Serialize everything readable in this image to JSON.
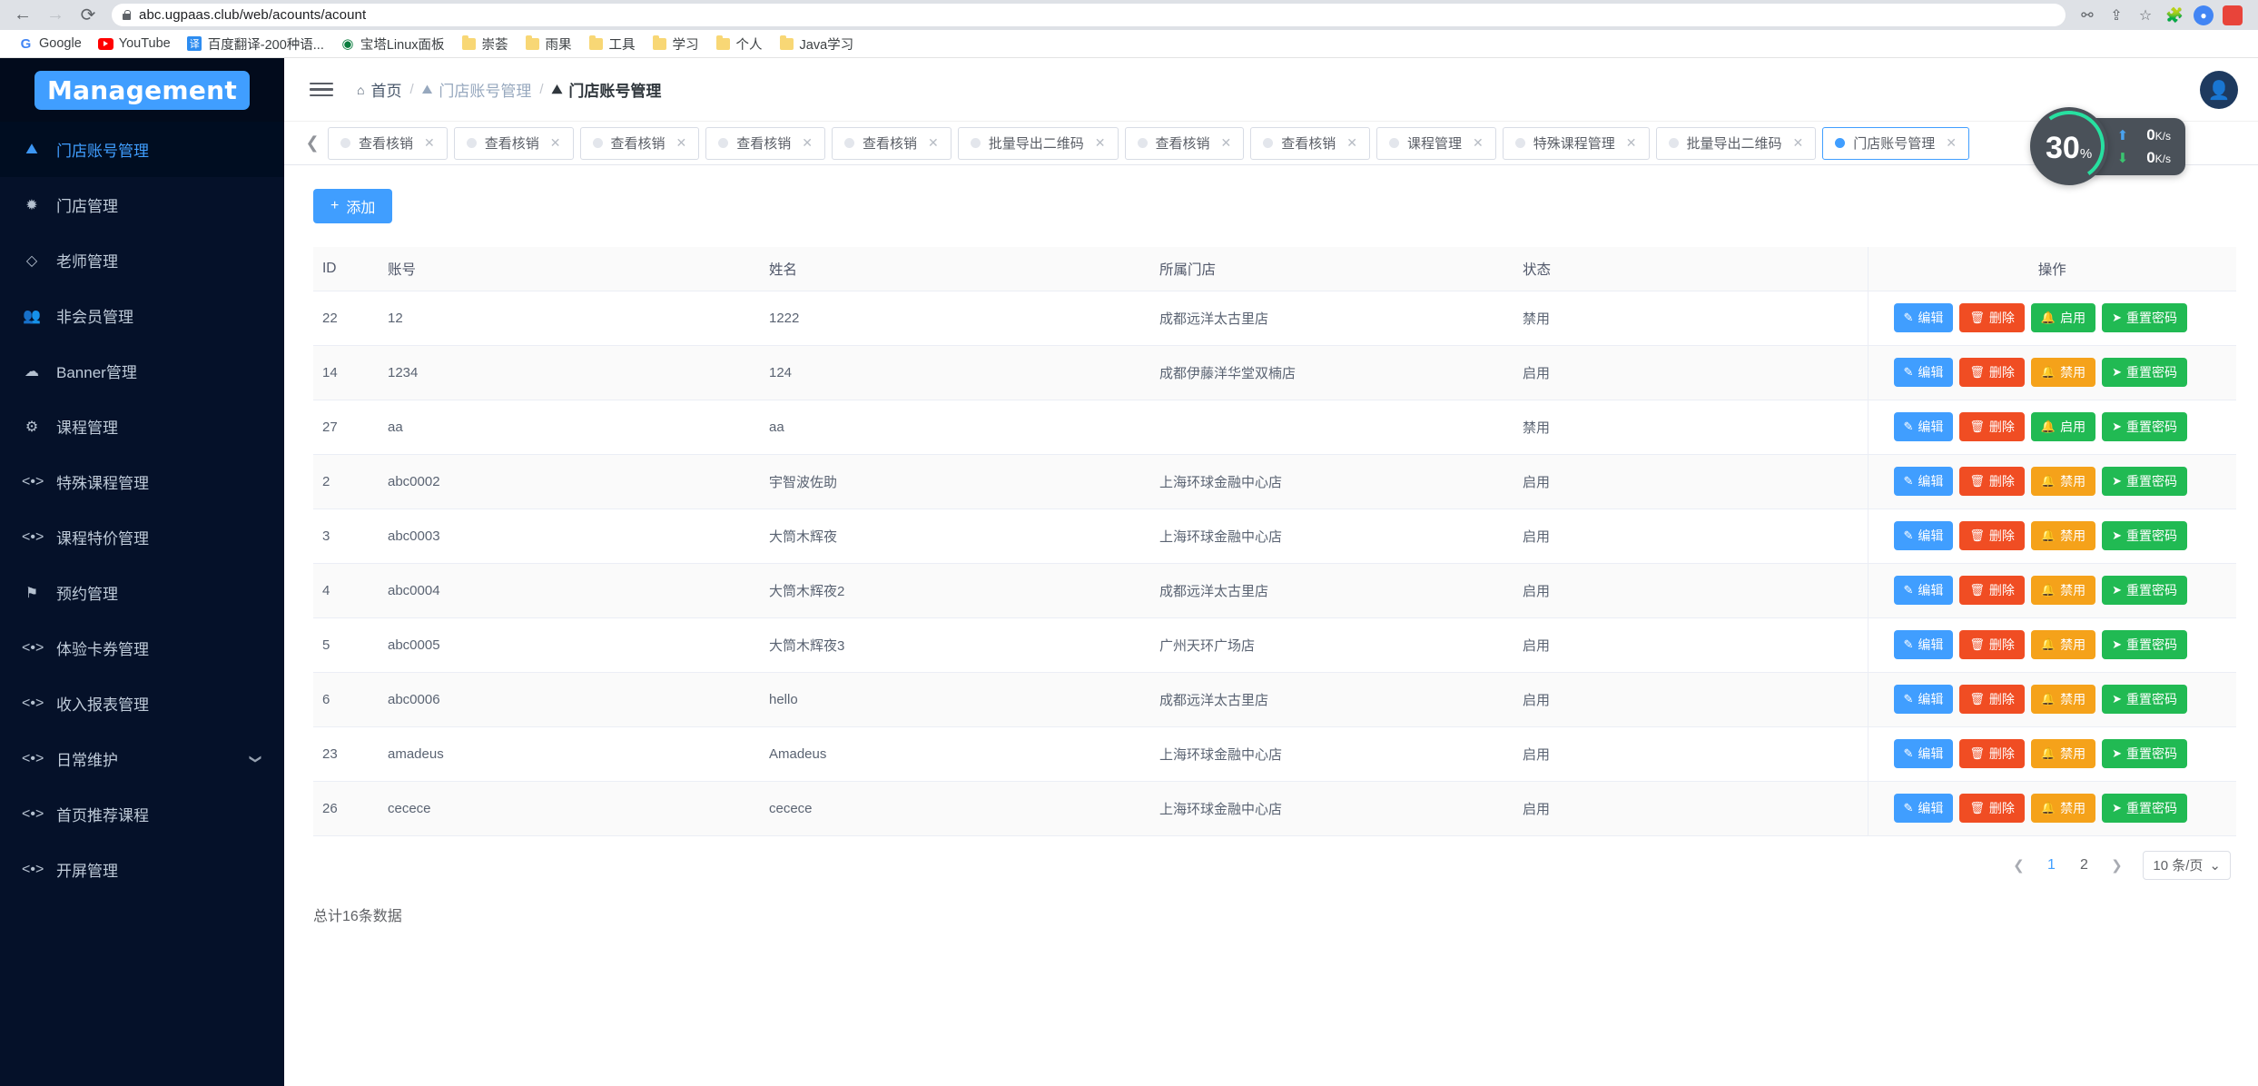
{
  "browser": {
    "url": "abc.ugpaas.club/web/acounts/acount",
    "back_label": "←",
    "forward_label": "→",
    "reload_label": "⟳",
    "bookmarks": [
      {
        "label": "Google",
        "icon": "google-icon"
      },
      {
        "label": "YouTube",
        "icon": "youtube-icon"
      },
      {
        "label": "百度翻译-200种语...",
        "icon": "translate-icon"
      },
      {
        "label": "宝塔Linux面板",
        "icon": "bt-panel-icon"
      },
      {
        "label": "崇荟",
        "icon": "folder-icon"
      },
      {
        "label": "雨果",
        "icon": "folder-icon"
      },
      {
        "label": "工具",
        "icon": "folder-icon"
      },
      {
        "label": "学习",
        "icon": "folder-icon"
      },
      {
        "label": "个人",
        "icon": "folder-icon"
      },
      {
        "label": "Java学习",
        "icon": "folder-icon"
      }
    ]
  },
  "sidebar": {
    "logo": "Management",
    "items": [
      {
        "label": "门店账号管理",
        "icon": "store-account-icon",
        "active": true,
        "expandable": false
      },
      {
        "label": "门店管理",
        "icon": "wrench-icon",
        "active": false,
        "expandable": false
      },
      {
        "label": "老师管理",
        "icon": "box-icon",
        "active": false,
        "expandable": false
      },
      {
        "label": "非会员管理",
        "icon": "people-icon",
        "active": false,
        "expandable": false
      },
      {
        "label": "Banner管理",
        "icon": "cloud-icon",
        "active": false,
        "expandable": false
      },
      {
        "label": "课程管理",
        "icon": "gear-icon",
        "active": false,
        "expandable": false
      },
      {
        "label": "特殊课程管理",
        "icon": "code-icon",
        "active": false,
        "expandable": false
      },
      {
        "label": "课程特价管理",
        "icon": "code-icon",
        "active": false,
        "expandable": false
      },
      {
        "label": "预约管理",
        "icon": "badge-icon",
        "active": false,
        "expandable": false
      },
      {
        "label": "体验卡券管理",
        "icon": "code-icon",
        "active": false,
        "expandable": false
      },
      {
        "label": "收入报表管理",
        "icon": "code-icon",
        "active": false,
        "expandable": false
      },
      {
        "label": "日常维护",
        "icon": "code-icon",
        "active": false,
        "expandable": true
      },
      {
        "label": "首页推荐课程",
        "icon": "code-icon",
        "active": false,
        "expandable": false
      },
      {
        "label": "开屏管理",
        "icon": "code-icon",
        "active": false,
        "expandable": false
      }
    ]
  },
  "topbar": {
    "menu_icon": "hamburger-icon",
    "breadcrumb": [
      {
        "label": "首页",
        "icon": "home-icon"
      },
      {
        "label": "门店账号管理",
        "icon": "store-account-icon"
      },
      {
        "label": "门店账号管理",
        "icon": "store-account-icon"
      }
    ],
    "avatar_icon": "user-avatar-icon"
  },
  "tabstrip": {
    "scroll_left_icon": "chevron-left-icon",
    "close_icon": "close-icon",
    "tabs": [
      {
        "label": "查看核销",
        "active": false
      },
      {
        "label": "查看核销",
        "active": false
      },
      {
        "label": "查看核销",
        "active": false
      },
      {
        "label": "查看核销",
        "active": false
      },
      {
        "label": "查看核销",
        "active": false
      },
      {
        "label": "批量导出二维码",
        "active": false
      },
      {
        "label": "查看核销",
        "active": false
      },
      {
        "label": "查看核销",
        "active": false
      },
      {
        "label": "课程管理",
        "active": false
      },
      {
        "label": "特殊课程管理",
        "active": false
      },
      {
        "label": "批量导出二维码",
        "active": false
      },
      {
        "label": "门店账号管理",
        "active": true
      }
    ]
  },
  "toolbar": {
    "add_label": "添加",
    "add_icon": "plus-icon"
  },
  "table": {
    "columns": [
      "ID",
      "账号",
      "姓名",
      "所属门店",
      "状态",
      "操作"
    ],
    "rows": [
      {
        "id": "22",
        "account": "12",
        "name": "1222",
        "store": "成都远洋太古里店",
        "status": "禁用",
        "toggle": "启用"
      },
      {
        "id": "14",
        "account": "1234",
        "name": "124",
        "store": "成都伊藤洋华堂双楠店",
        "status": "启用",
        "toggle": "禁用"
      },
      {
        "id": "27",
        "account": "aa",
        "name": "aa",
        "store": "",
        "status": "禁用",
        "toggle": "启用"
      },
      {
        "id": "2",
        "account": "abc0002",
        "name": "宇智波佐助",
        "store": "上海环球金融中心店",
        "status": "启用",
        "toggle": "禁用"
      },
      {
        "id": "3",
        "account": "abc0003",
        "name": "大筒木辉夜",
        "store": "上海环球金融中心店",
        "status": "启用",
        "toggle": "禁用"
      },
      {
        "id": "4",
        "account": "abc0004",
        "name": "大筒木辉夜2",
        "store": "成都远洋太古里店",
        "status": "启用",
        "toggle": "禁用"
      },
      {
        "id": "5",
        "account": "abc0005",
        "name": "大筒木辉夜3",
        "store": "广州天环广场店",
        "status": "启用",
        "toggle": "禁用"
      },
      {
        "id": "6",
        "account": "abc0006",
        "name": "hello",
        "store": "成都远洋太古里店",
        "status": "启用",
        "toggle": "禁用"
      },
      {
        "id": "23",
        "account": "amadeus",
        "name": "Amadeus",
        "store": "上海环球金融中心店",
        "status": "启用",
        "toggle": "禁用"
      },
      {
        "id": "26",
        "account": "cecece",
        "name": "cecece",
        "store": "上海环球金融中心店",
        "status": "启用",
        "toggle": "禁用"
      }
    ],
    "row_actions": {
      "edit": "编辑",
      "edit_icon": "pencil-icon",
      "delete": "删除",
      "delete_icon": "trash-icon",
      "toggle_icon": "bell-icon",
      "reset": "重置密码",
      "reset_icon": "share-icon"
    }
  },
  "footer": {
    "total_text": "总计16条数据",
    "pagination": {
      "prev_icon": "chevron-left-icon",
      "next_icon": "chevron-right-icon",
      "pages": [
        "1",
        "2"
      ],
      "current": "1"
    },
    "page_size": "10 条/页",
    "page_size_icon": "chevron-down-icon"
  },
  "net_widget": {
    "percent": "30",
    "percent_symbol": "%",
    "upload": "0",
    "upload_unit": "K/s",
    "upload_icon": "arrow-up-icon",
    "download": "0",
    "download_unit": "K/s",
    "download_icon": "arrow-down-icon"
  },
  "colors": {
    "accent": "#409eff",
    "danger": "#f04d23",
    "success": "#21ba53",
    "warning": "#f5a21a",
    "sidebar_bg": "#051129"
  }
}
